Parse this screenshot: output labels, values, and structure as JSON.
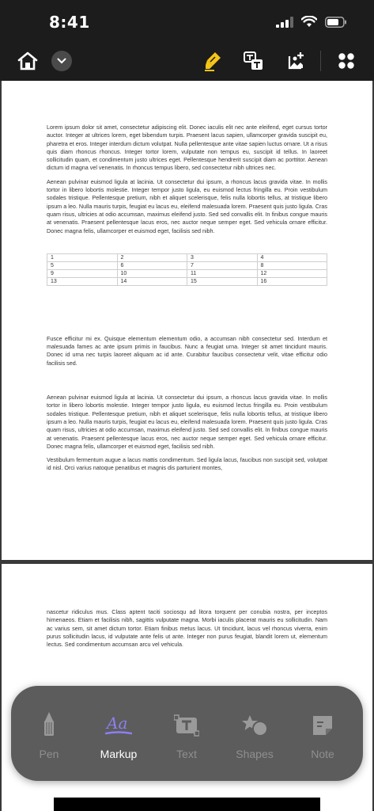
{
  "status_bar": {
    "time": "8:41"
  },
  "document": {
    "page1": {
      "paragraphs_top": [
        "Lorem ipsum dolor sit amet, consectetur adipiscing elit. Donec iaculis elit nec ante eleifend, eget cursus tortor auctor. Integer at ultrices lorem, eget bibendum turpis. Praesent lacus sapien, ullamcorper gravida suscipit eu, pharetra et eros. Integer interdum dictum volutpat. Nulla pellentesque ante vitae sapien luctus ornare. Ut a risus quis diam rhoncus rhoncus. Integer tortor lorem, vulputate non tempus eu, suscipit id tellus. In laoreet sollicitudin quam, et condimentum justo ultrices eget. Pellentesque hendrerit suscipit diam ac porttitor. Aenean dictum id magna vel venenatis. In rhoncus tempus libero, sed consectetur nibh ultrices nec.",
        "Aenean pulvinar euismod ligula at lacinia. Ut consectetur dui ipsum, a rhoncus lacus gravida vitae. In mollis tortor in libero lobortis molestie. Integer tempor justo ligula, eu euismod lectus fringilla eu. Proin vestibulum sodales tristique. Pellentesque pretium, nibh et aliquet scelerisque, felis nulla lobortis tellus, at tristique libero ipsum a leo. Nulla mauris turpis, feugiat eu lacus eu, eleifend malesuada lorem. Praesent quis justo ligula. Cras quam risus, ultricies at odio accumsan, maximus eleifend justo. Sed sed convallis elit. In finibus congue mauris at venenatis. Praesent pellentesque lacus eros, nec auctor neque semper eget. Sed vehicula ornare efficitur. Donec magna felis, ullamcorper et euismod eget, facilisis sed nibh."
      ],
      "table_rows": [
        [
          "1",
          "2",
          "3",
          "4"
        ],
        [
          "5",
          "6",
          "7",
          "8"
        ],
        [
          "9",
          "10",
          "11",
          "12"
        ],
        [
          "13",
          "14",
          "15",
          "16"
        ]
      ],
      "paragraph_mid": "Fusce efficitur mi ex. Quisque elementum elementum odio, a accumsan nibh consectetur sed. Interdum et malesuada fames ac ante ipsum primis in faucibus. Nunc a feugiat urna. Integer sit amet tincidunt mauris. Donec id urna nec turpis laoreet aliquam ac id ante. Curabitur faucibus consectetur velit, vitae efficitur odio facilisis sed.",
      "paragraphs_bottom": [
        "Aenean pulvinar euismod ligula at lacinia. Ut consectetur dui ipsum, a rhoncus lacus gravida vitae. In mollis tortor in libero lobortis molestie. Integer tempor justo ligula, eu euismod lectus fringilla eu. Proin vestibulum sodales tristique. Pellentesque pretium, nibh et aliquet scelerisque, felis nulla lobortis tellus, at tristique libero ipsum a leo. Nulla mauris turpis, feugiat eu lacus eu, eleifend malesuada lorem. Praesent quis justo ligula. Cras quam risus, ultricies at odio accumsan, maximus eleifend justo. Sed sed convallis elit. In finibus congue mauris at venenatis. Praesent pellentesque lacus eros, nec auctor neque semper eget. Sed vehicula ornare efficitur. Donec magna felis, ullamcorper et euismod eget, facilisis sed nibh.",
        "Vestibulum fermentum augue a lacus mattis condimentum. Sed ligula lacus, faucibus non suscipit sed, volutpat id nisl. Orci varius natoque penatibus et magnis dis parturient montes,"
      ]
    },
    "page2": {
      "paragraph": "nascetur ridiculus mus. Class aptent taciti sociosqu ad litora torquent per conubia nostra, per inceptos himenaeos. Etiam et facilisis nibh, sagittis vulputate magna. Morbi iaculis placerat mauris eu sollicitudin. Nam ac varius sem, sit amet dictum tortor. Etiam finibus metus lacus. Ut tincidunt, lacus vel rhoncus viverra, enim purus sollicitudin lacus, id vulputate ante felis ut ante. Integer non purus feugiat, blandit lorem ut, elementum lectus. Sed condimentum accumsan arcu vel vehicula."
    }
  },
  "tools": {
    "items": [
      {
        "label": "Pen",
        "icon": "pen-icon",
        "active": false
      },
      {
        "label": "Markup",
        "icon": "markup-icon",
        "active": true
      },
      {
        "label": "Text",
        "icon": "text-box-icon",
        "active": false
      },
      {
        "label": "Shapes",
        "icon": "shapes-icon",
        "active": false
      },
      {
        "label": "Note",
        "icon": "note-icon",
        "active": false
      }
    ],
    "accent_color": "#8b7ff0",
    "highlighter_color": "#f5c518"
  }
}
